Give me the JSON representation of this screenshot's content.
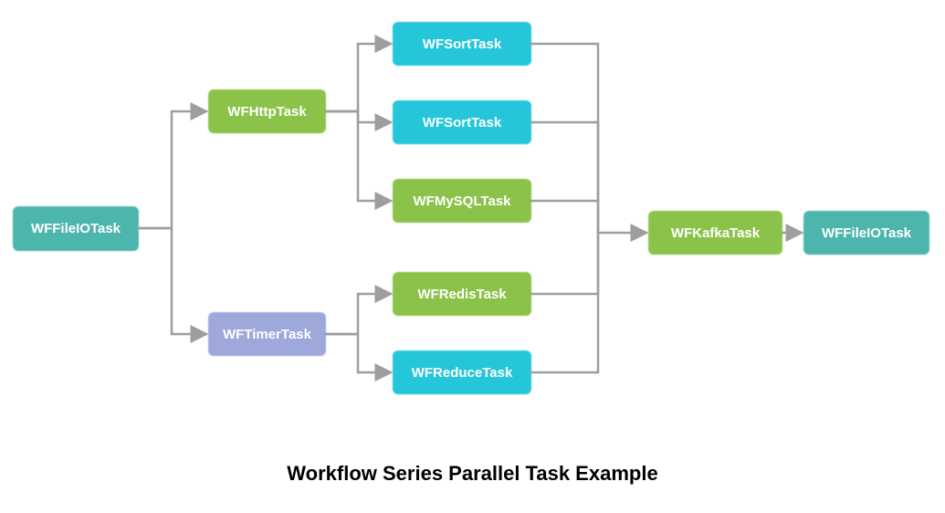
{
  "title": "Workflow Series Parallel Task Example",
  "nodes": {
    "fileio1": {
      "label": "WFFileIOTask",
      "color": "teal"
    },
    "http": {
      "label": "WFHttpTask",
      "color": "green"
    },
    "timer": {
      "label": "WFTimerTask",
      "color": "purple"
    },
    "sort1": {
      "label": "WFSortTask",
      "color": "cyan"
    },
    "sort2": {
      "label": "WFSortTask",
      "color": "cyan"
    },
    "mysql": {
      "label": "WFMySQLTask",
      "color": "green"
    },
    "redis": {
      "label": "WFRedisTask",
      "color": "green"
    },
    "reduce": {
      "label": "WFReduceTask",
      "color": "cyan"
    },
    "kafka": {
      "label": "WFKafkaTask",
      "color": "green"
    },
    "fileio2": {
      "label": "WFFileIOTask",
      "color": "teal"
    }
  },
  "edges": [
    {
      "from": "fileio1",
      "to": "http"
    },
    {
      "from": "fileio1",
      "to": "timer"
    },
    {
      "from": "http",
      "to": "sort1"
    },
    {
      "from": "http",
      "to": "sort2"
    },
    {
      "from": "http",
      "to": "mysql"
    },
    {
      "from": "timer",
      "to": "redis"
    },
    {
      "from": "timer",
      "to": "reduce"
    },
    {
      "from": "sort1",
      "to": "kafka"
    },
    {
      "from": "sort2",
      "to": "kafka"
    },
    {
      "from": "mysql",
      "to": "kafka"
    },
    {
      "from": "redis",
      "to": "kafka"
    },
    {
      "from": "reduce",
      "to": "kafka"
    },
    {
      "from": "kafka",
      "to": "fileio2"
    }
  ]
}
